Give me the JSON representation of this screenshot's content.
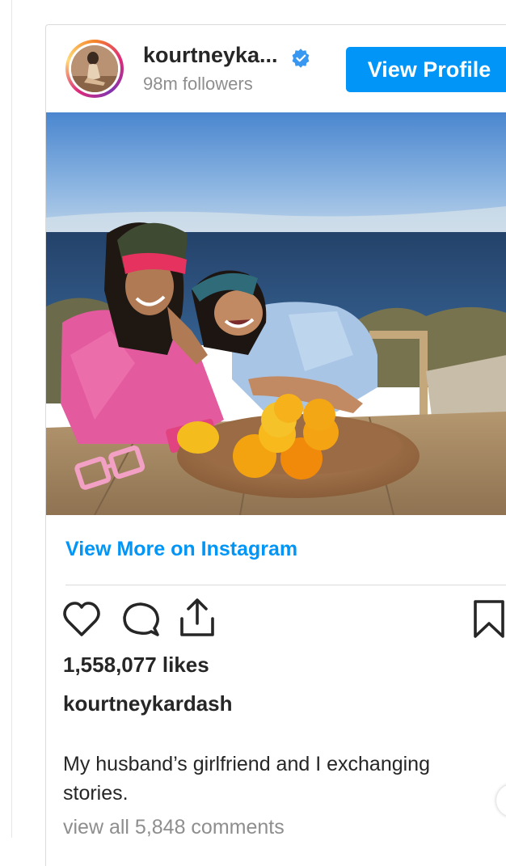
{
  "post": {
    "username": "kourtneyka...",
    "followers": "98m followers",
    "view_profile_label": "View Profile",
    "view_more_label": "View More on Instagram",
    "likes": "1,558,077 likes",
    "caption_user": "kourtneykardash",
    "caption": "My husband’s girlfriend and I exchanging stories.",
    "comments_link": "view all 5,848 comments"
  },
  "icons": {
    "verified": "verified-badge-icon",
    "like": "heart-icon",
    "comment": "comment-bubble-icon",
    "share": "share-icon",
    "save": "bookmark-icon"
  },
  "colors": {
    "accent": "#0095f6",
    "text": "#262626",
    "muted": "#8e8e8e"
  }
}
